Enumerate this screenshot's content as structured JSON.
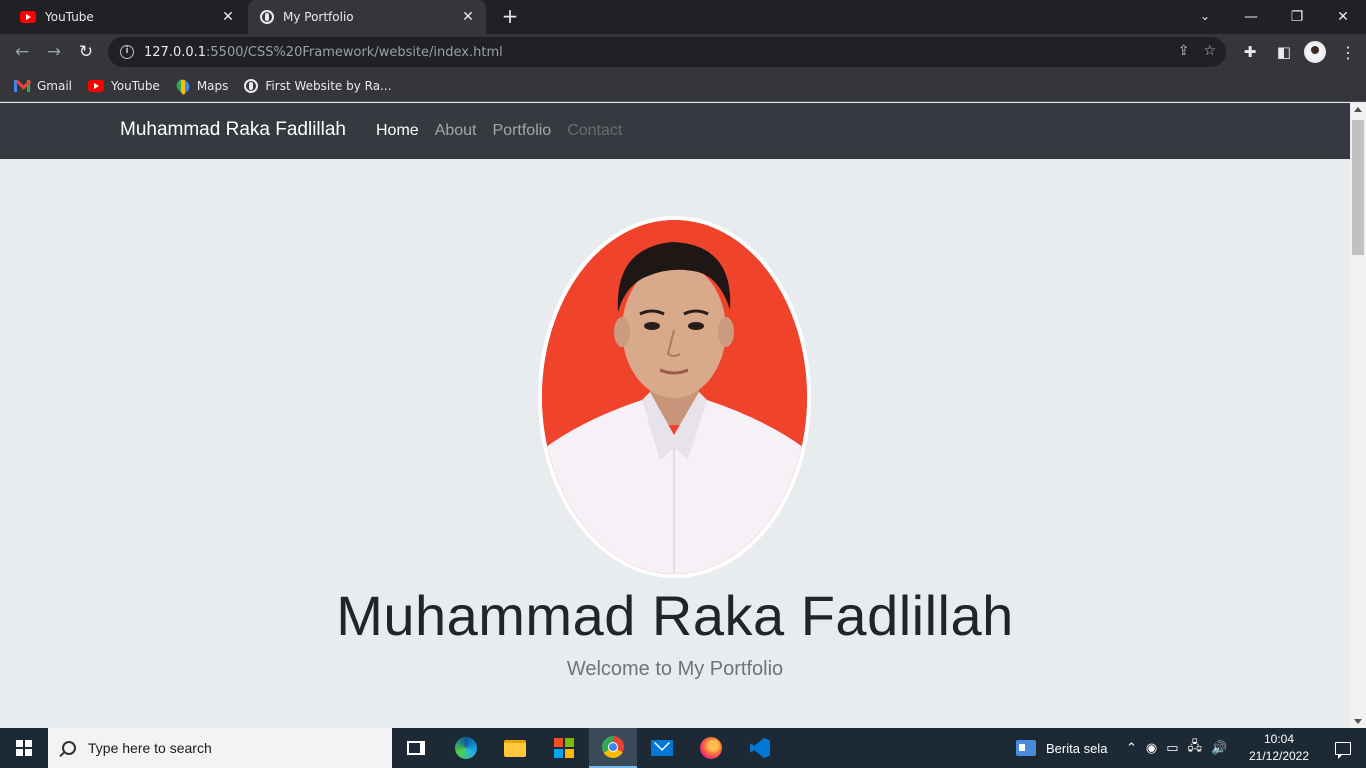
{
  "browser": {
    "tabs": [
      {
        "title": "YouTube",
        "active": false
      },
      {
        "title": "My Portfolio",
        "active": true
      }
    ],
    "url": {
      "host": "127.0.0.1",
      "rest": ":5500/CSS%20Framework/website/index.html"
    },
    "bookmarks": [
      {
        "label": "Gmail",
        "icon": "gmail-icon"
      },
      {
        "label": "YouTube",
        "icon": "youtube-icon"
      },
      {
        "label": "Maps",
        "icon": "maps-icon"
      },
      {
        "label": "First Website by Ra...",
        "icon": "globe-icon"
      }
    ]
  },
  "site": {
    "brand": "Muhammad Raka Fadlillah",
    "nav": [
      {
        "label": "Home",
        "state": "active"
      },
      {
        "label": "About",
        "state": "normal"
      },
      {
        "label": "Portfolio",
        "state": "normal"
      },
      {
        "label": "Contact",
        "state": "muted"
      }
    ],
    "hero": {
      "name": "Muhammad Raka Fadlillah",
      "subtitle": "Welcome to My Portfolio"
    }
  },
  "taskbar": {
    "search_placeholder": "Type here to search",
    "news": "Berita sela",
    "time": "10:04",
    "date": "21/12/2022"
  },
  "colors": {
    "site_nav_bg": "#343a40",
    "page_bg": "#e9ecef",
    "photo_bg": "#f0432b"
  }
}
